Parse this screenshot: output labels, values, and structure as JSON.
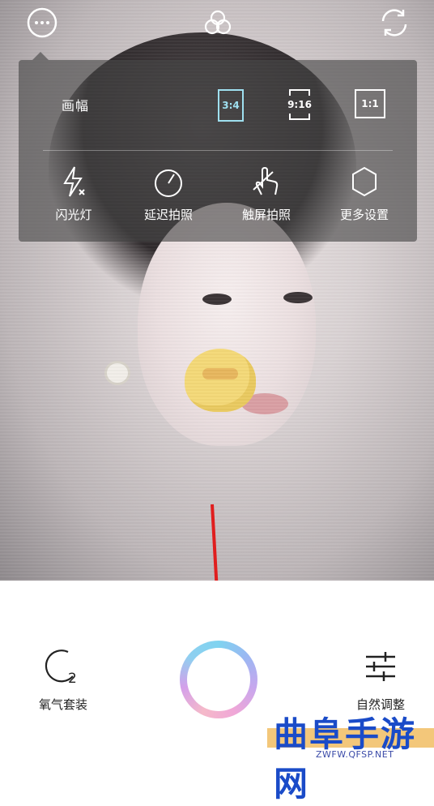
{
  "popup": {
    "aspect_label": "画幅",
    "ratios": [
      "3:4",
      "9:16",
      "1:1"
    ],
    "selected_ratio": "3:4",
    "tools": [
      {
        "label": "闪光灯",
        "icon": "flash-off-icon"
      },
      {
        "label": "延迟拍照",
        "icon": "timer-icon"
      },
      {
        "label": "触屏拍照",
        "icon": "touch-capture-icon"
      },
      {
        "label": "更多设置",
        "icon": "settings-icon"
      }
    ]
  },
  "topbar": {
    "icons": [
      "more-icon",
      "filter-icon",
      "switch-camera-icon"
    ]
  },
  "bottom": {
    "left_label": "氧气套装",
    "right_label": "自然调整",
    "left_icon": "oxygen-kit-icon",
    "right_icon": "adjust-sliders-icon",
    "shutter_icon": "shutter-button"
  },
  "watermark": {
    "text": "曲阜手游网",
    "url": "ZWFW.QFSP.NET"
  },
  "colors": {
    "selected_ratio": "#9fe0f0",
    "annotation_arrow": "#e01e1e",
    "watermark_blue": "#1a4bc8"
  }
}
